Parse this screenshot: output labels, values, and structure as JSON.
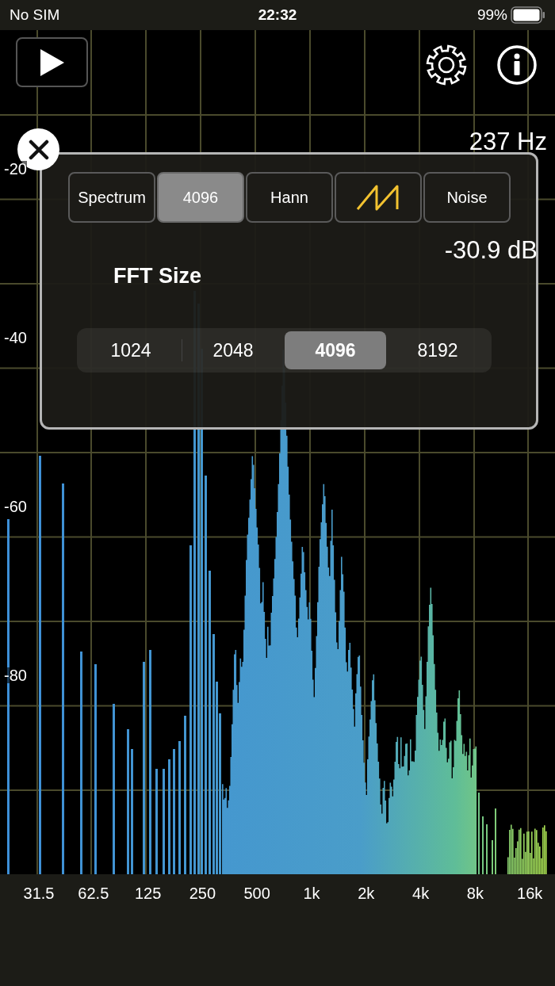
{
  "status_bar": {
    "carrier": "No SIM",
    "time": "22:32",
    "battery": "99%"
  },
  "readout": {
    "frequency": "237 Hz",
    "level": "-30.9 dB"
  },
  "mode_buttons": [
    {
      "kind": "text",
      "label": "Spectrum",
      "selected": false
    },
    {
      "kind": "text",
      "label": "4096",
      "selected": true
    },
    {
      "kind": "text",
      "label": "Hann",
      "selected": false
    },
    {
      "kind": "icon",
      "selected": false
    },
    {
      "kind": "text",
      "label": "Noise",
      "selected": false
    }
  ],
  "fft_size": {
    "title": "FFT Size",
    "options": [
      {
        "label": "1024",
        "selected": false
      },
      {
        "label": "2048",
        "selected": false
      },
      {
        "label": "4096",
        "selected": true
      },
      {
        "label": "8192",
        "selected": false
      }
    ]
  },
  "y_axis": [
    "-20",
    "-40",
    "-60",
    "-80"
  ],
  "x_axis": [
    "31.5",
    "62.5",
    "125",
    "250",
    "500",
    "1k",
    "2k",
    "4k",
    "8k",
    "16k"
  ]
}
